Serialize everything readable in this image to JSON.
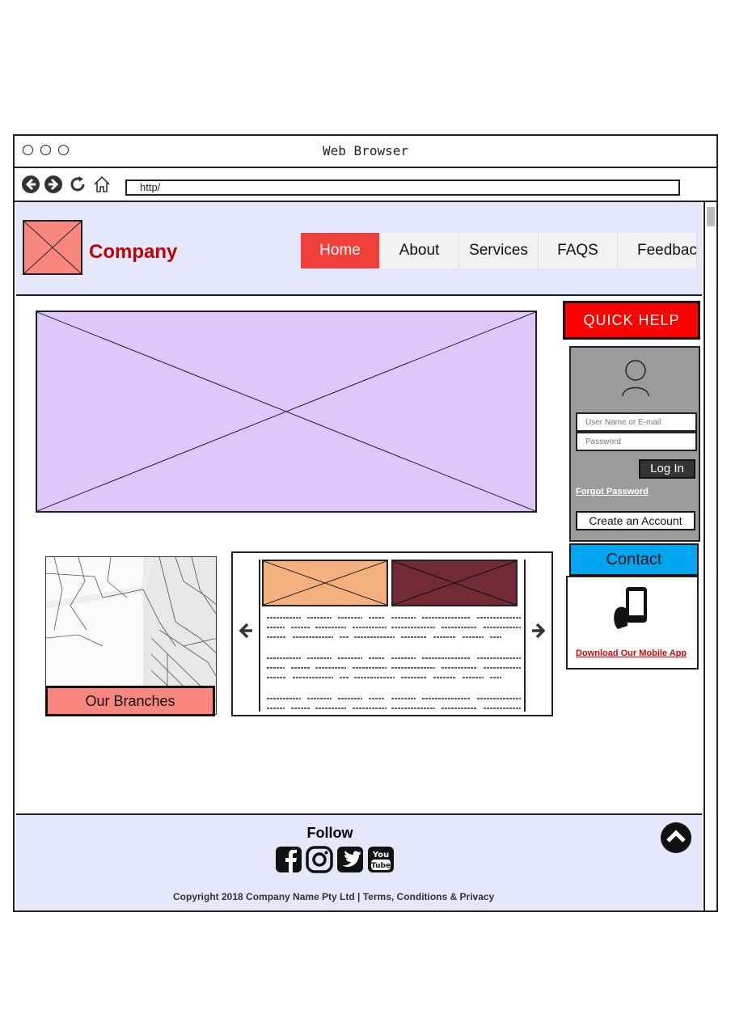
{
  "browser": {
    "title": "Web Browser",
    "url": "http/",
    "icons": [
      "back-icon",
      "forward-icon",
      "reload-icon",
      "home-icon"
    ]
  },
  "header": {
    "company": "Company",
    "nav": [
      {
        "label": "Home",
        "active": true
      },
      {
        "label": "About",
        "active": false
      },
      {
        "label": "Services",
        "active": false
      },
      {
        "label": "FAQS",
        "active": false
      },
      {
        "label": "Feedbac",
        "active": false
      }
    ]
  },
  "sidebar": {
    "quick_help": "QUICK HELP",
    "login": {
      "username_placeholder": "User Name or E-mail",
      "password_placeholder": "Password",
      "login_button": "Log In",
      "forgot_password": "Forgot Password",
      "create_account": "Create an Account"
    },
    "contact": "Contact",
    "download_app": "Download Our Mobile App"
  },
  "content": {
    "branches_label": "Our Branches"
  },
  "footer": {
    "follow": "Follow",
    "social_icons": [
      "facebook-icon",
      "instagram-icon",
      "twitter-icon",
      "youtube-icon"
    ],
    "copyright": "Copyright 2018 Company Name Pty Ltd  |  Terms, Conditions & Privacy"
  },
  "colors": {
    "header_bg": "#e5e8fb",
    "active_nav": "#f0403a",
    "company_text": "#c00000",
    "quick_help": "#ff0000",
    "login_panel": "#9b9b9b",
    "contact": "#00a5f0",
    "hero": "#dfc6fb",
    "branches": "#f7877f",
    "carousel_img_1": "#f4b07e",
    "carousel_img_2": "#722b36"
  }
}
